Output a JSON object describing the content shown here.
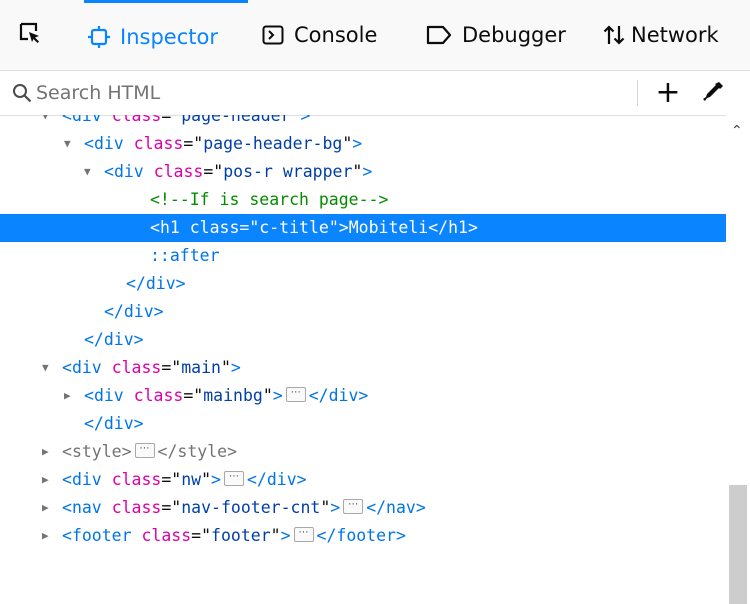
{
  "toolbar": {
    "tabs": [
      {
        "label": "Inspector",
        "icon": "inspector-icon",
        "active": true
      },
      {
        "label": "Console",
        "icon": "console-icon",
        "active": false
      },
      {
        "label": "Debugger",
        "icon": "debugger-icon",
        "active": false
      },
      {
        "label": "Network",
        "icon": "network-icon",
        "active": false
      }
    ],
    "accent_color": "#0a84ff"
  },
  "search": {
    "placeholder": "Search HTML",
    "value": ""
  },
  "actions": {
    "add_label": "+"
  },
  "tree": {
    "lines": [
      {
        "partial": true,
        "tag": "div",
        "attr": "class",
        "val": "page-header",
        "close": ">"
      },
      {
        "tag": "div",
        "attr": "class",
        "val": "page-header-bg",
        "close": ">"
      },
      {
        "tag": "div",
        "attr": "class",
        "val": "pos-r wrapper",
        "close": ">"
      },
      {
        "comment": "<!--If is search page-->"
      },
      {
        "tag": "h1",
        "attr": "class",
        "val": "c-title",
        "text": "Mobiteli",
        "end": "</h1>",
        "selected": true
      },
      {
        "pseudo": "::after"
      },
      {
        "end_tag": "</div>"
      },
      {
        "end_tag": "</div>"
      },
      {
        "end_tag": "</div>"
      },
      {
        "tag": "div",
        "attr": "class",
        "val": "main",
        "close": ">"
      },
      {
        "tag": "div",
        "attr": "class",
        "val": "mainbg",
        "collapsed": true,
        "end": "</div>"
      },
      {
        "end_tag": "</div>"
      },
      {
        "tag": "style",
        "collapsed": true,
        "end": "</style>",
        "gray": true
      },
      {
        "tag": "div",
        "attr": "class",
        "val": "nw",
        "collapsed": true,
        "end": "</div>"
      },
      {
        "tag": "nav",
        "attr": "class",
        "val": "nav-footer-cnt",
        "collapsed": true,
        "end": "</nav>"
      },
      {
        "tag": "footer",
        "attr": "class",
        "val": "footer",
        "collapsed": true,
        "end": "</footer>"
      }
    ]
  }
}
